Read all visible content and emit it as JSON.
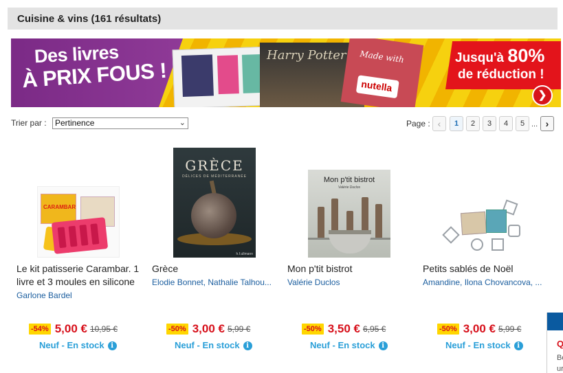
{
  "header": {
    "title": "Cuisine & vins (161 résultats)"
  },
  "banner": {
    "left_line1": "Des livres",
    "left_line2": "À PRIX FOUS !",
    "book2_title": "Harry Potter",
    "book3_text": "Made with",
    "book3_brand": "nutella",
    "right_prefix": "Jusqu'à ",
    "right_percent": "80%",
    "right_line2": "de réduction !",
    "button_glyph": "❯"
  },
  "sort": {
    "label": "Trier par :",
    "selected": "Pertinence"
  },
  "pagination": {
    "label": "Page :",
    "prev_glyph": "‹",
    "next_glyph": "›",
    "pages": [
      "1",
      "2",
      "3",
      "4",
      "5"
    ],
    "current": "1",
    "ellipsis": "..."
  },
  "products": [
    {
      "title": "Le kit patisserie Carambar. 1 livre et 3 moules en silicone",
      "author": "Garlone Bardel",
      "discount": "-54%",
      "price": "5,00 €",
      "old_price": "10,95 €",
      "stock": "Neuf - En stock",
      "cover_text": "CARAMBAR"
    },
    {
      "title": "Grèce",
      "author": "Elodie Bonnet, Nathalie Talhou...",
      "discount": "-50%",
      "price": "3,00 €",
      "old_price": "5,99 €",
      "stock": "Neuf - En stock",
      "cover_title": "GRÈCE",
      "cover_subtitle": "DÉLICES DE MÉDITERRANÉE",
      "cover_publisher": "h.f.ullmann"
    },
    {
      "title": "Mon p'tit bistrot",
      "author": "Valérie Duclos",
      "discount": "-50%",
      "price": "3,50 €",
      "old_price": "6,95 €",
      "stock": "Neuf - En stock",
      "cover_title": "Mon p'tit bistrot",
      "cover_subtitle": "Valérie Duclos"
    },
    {
      "title": "Petits sablés de Noël",
      "author": "Amandine, Ilona Chovancova, ...",
      "discount": "-50%",
      "price": "3,00 €",
      "old_price": "5,99 €",
      "stock": "Neuf - En stock"
    }
  ],
  "edge_widget": {
    "q": "Q",
    "line1": "Bo",
    "line2": "ur"
  },
  "icons": {
    "info": "info-icon",
    "select_chevron": "chevron-down-icon"
  },
  "colors": {
    "price_red": "#d70f1a",
    "discount_bg": "#ffd600",
    "stock_blue": "#2a9fd8",
    "author_blue": "#1a5d9e"
  }
}
